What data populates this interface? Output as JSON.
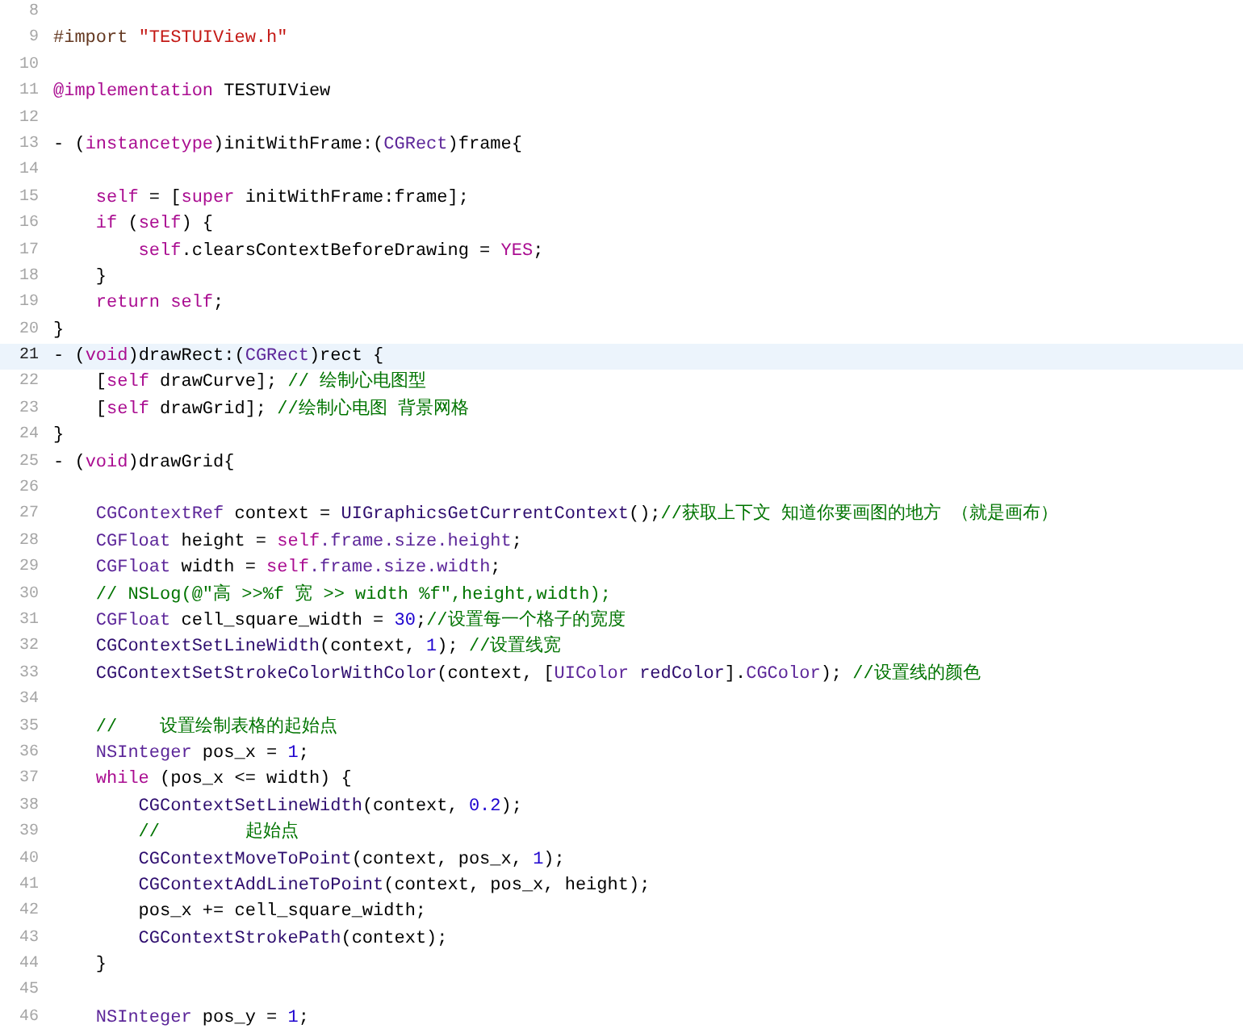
{
  "editor": {
    "lines": [
      {
        "number": "8",
        "current": false
      },
      {
        "number": "9",
        "current": false,
        "tokens": [
          {
            "kind": "preproc",
            "text": "#import "
          },
          {
            "kind": "string",
            "text": "\"TESTUIView.h\""
          }
        ]
      },
      {
        "number": "10",
        "current": false
      },
      {
        "number": "11",
        "current": false,
        "tokens": [
          {
            "kind": "keyword",
            "text": "@implementation"
          },
          {
            "kind": "plain",
            "text": " TESTUIView"
          }
        ]
      },
      {
        "number": "12",
        "current": false
      },
      {
        "number": "13",
        "current": false,
        "tokens": [
          {
            "kind": "plain",
            "text": "- ("
          },
          {
            "kind": "keyword",
            "text": "instancetype"
          },
          {
            "kind": "plain",
            "text": ")initWithFrame:("
          },
          {
            "kind": "type",
            "text": "CGRect"
          },
          {
            "kind": "plain",
            "text": ")frame{"
          }
        ]
      },
      {
        "number": "14",
        "current": false
      },
      {
        "number": "15",
        "current": false,
        "tokens": [
          {
            "kind": "keyword",
            "text": "    self"
          },
          {
            "kind": "plain",
            "text": " = ["
          },
          {
            "kind": "keyword",
            "text": "super"
          },
          {
            "kind": "plain",
            "text": " initWithFrame:frame];"
          }
        ]
      },
      {
        "number": "16",
        "current": false,
        "tokens": [
          {
            "kind": "keyword",
            "text": "    if"
          },
          {
            "kind": "plain",
            "text": " ("
          },
          {
            "kind": "keyword",
            "text": "self"
          },
          {
            "kind": "plain",
            "text": ") {"
          }
        ]
      },
      {
        "number": "17",
        "current": false,
        "tokens": [
          {
            "kind": "keyword",
            "text": "        self"
          },
          {
            "kind": "plain",
            "text": ".clearsContextBeforeDrawing = "
          },
          {
            "kind": "keyword",
            "text": "YES"
          },
          {
            "kind": "plain",
            "text": ";"
          }
        ]
      },
      {
        "number": "18",
        "current": false,
        "tokens": [
          {
            "kind": "plain",
            "text": "    }"
          }
        ]
      },
      {
        "number": "19",
        "current": false,
        "tokens": [
          {
            "kind": "keyword",
            "text": "    return self"
          },
          {
            "kind": "plain",
            "text": ";"
          }
        ]
      },
      {
        "number": "20",
        "current": false,
        "tokens": [
          {
            "kind": "plain",
            "text": "}"
          }
        ]
      },
      {
        "number": "21",
        "current": true,
        "tokens": [
          {
            "kind": "plain",
            "text": "- ("
          },
          {
            "kind": "keyword",
            "text": "void"
          },
          {
            "kind": "plain",
            "text": ")drawRect:("
          },
          {
            "kind": "type",
            "text": "CGRect"
          },
          {
            "kind": "plain",
            "text": ")rect {"
          }
        ]
      },
      {
        "number": "22",
        "current": false,
        "tokens": [
          {
            "kind": "plain",
            "text": "    ["
          },
          {
            "kind": "keyword",
            "text": "self"
          },
          {
            "kind": "plain",
            "text": " drawCurve]; "
          },
          {
            "kind": "comment",
            "text": "// 绘制心电图型"
          }
        ]
      },
      {
        "number": "23",
        "current": false,
        "tokens": [
          {
            "kind": "plain",
            "text": "    ["
          },
          {
            "kind": "keyword",
            "text": "self"
          },
          {
            "kind": "plain",
            "text": " drawGrid]; "
          },
          {
            "kind": "comment",
            "text": "//绘制心电图 背景网格"
          }
        ]
      },
      {
        "number": "24",
        "current": false,
        "tokens": [
          {
            "kind": "plain",
            "text": "}"
          }
        ]
      },
      {
        "number": "25",
        "current": false,
        "tokens": [
          {
            "kind": "plain",
            "text": "- ("
          },
          {
            "kind": "keyword",
            "text": "void"
          },
          {
            "kind": "plain",
            "text": ")drawGrid{"
          }
        ]
      },
      {
        "number": "26",
        "current": false
      },
      {
        "number": "27",
        "current": false,
        "tokens": [
          {
            "kind": "type",
            "text": "    CGContextRef"
          },
          {
            "kind": "plain",
            "text": " context = "
          },
          {
            "kind": "func",
            "text": "UIGraphicsGetCurrentContext"
          },
          {
            "kind": "plain",
            "text": "();"
          },
          {
            "kind": "comment",
            "text": "//获取上下文 知道你要画图的地方 （就是画布）"
          }
        ]
      },
      {
        "number": "28",
        "current": false,
        "tokens": [
          {
            "kind": "type",
            "text": "    CGFloat"
          },
          {
            "kind": "plain",
            "text": " height = "
          },
          {
            "kind": "keyword",
            "text": "self"
          },
          {
            "kind": "prop",
            "text": ".frame.size.height"
          },
          {
            "kind": "plain",
            "text": ";"
          }
        ]
      },
      {
        "number": "29",
        "current": false,
        "tokens": [
          {
            "kind": "type",
            "text": "    CGFloat"
          },
          {
            "kind": "plain",
            "text": " width = "
          },
          {
            "kind": "keyword",
            "text": "self"
          },
          {
            "kind": "prop",
            "text": ".frame.size.width"
          },
          {
            "kind": "plain",
            "text": ";"
          }
        ]
      },
      {
        "number": "30",
        "current": false,
        "tokens": [
          {
            "kind": "comment",
            "text": "    // NSLog(@\"高 >>%f 宽 >> width %f\",height,width);"
          }
        ]
      },
      {
        "number": "31",
        "current": false,
        "tokens": [
          {
            "kind": "type",
            "text": "    CGFloat"
          },
          {
            "kind": "plain",
            "text": " cell_square_width = "
          },
          {
            "kind": "number",
            "text": "30"
          },
          {
            "kind": "plain",
            "text": ";"
          },
          {
            "kind": "comment",
            "text": "//设置每一个格子的宽度"
          }
        ]
      },
      {
        "number": "32",
        "current": false,
        "tokens": [
          {
            "kind": "func",
            "text": "    CGContextSetLineWidth"
          },
          {
            "kind": "plain",
            "text": "(context, "
          },
          {
            "kind": "number",
            "text": "1"
          },
          {
            "kind": "plain",
            "text": "); "
          },
          {
            "kind": "comment",
            "text": "//设置线宽"
          }
        ]
      },
      {
        "number": "33",
        "current": false,
        "tokens": [
          {
            "kind": "func",
            "text": "    CGContextSetStrokeColorWithColor"
          },
          {
            "kind": "plain",
            "text": "(context, ["
          },
          {
            "kind": "type",
            "text": "UIColor"
          },
          {
            "kind": "func",
            "text": " redColor"
          },
          {
            "kind": "plain",
            "text": "]."
          },
          {
            "kind": "prop",
            "text": "CGColor"
          },
          {
            "kind": "plain",
            "text": "); "
          },
          {
            "kind": "comment",
            "text": "//设置线的颜色"
          }
        ]
      },
      {
        "number": "34",
        "current": false
      },
      {
        "number": "35",
        "current": false,
        "tokens": [
          {
            "kind": "comment",
            "text": "    //    设置绘制表格的起始点"
          }
        ]
      },
      {
        "number": "36",
        "current": false,
        "tokens": [
          {
            "kind": "type",
            "text": "    NSInteger"
          },
          {
            "kind": "plain",
            "text": " pos_x = "
          },
          {
            "kind": "number",
            "text": "1"
          },
          {
            "kind": "plain",
            "text": ";"
          }
        ]
      },
      {
        "number": "37",
        "current": false,
        "tokens": [
          {
            "kind": "keyword",
            "text": "    while"
          },
          {
            "kind": "plain",
            "text": " (pos_x <= width) {"
          }
        ]
      },
      {
        "number": "38",
        "current": false,
        "tokens": [
          {
            "kind": "func",
            "text": "        CGContextSetLineWidth"
          },
          {
            "kind": "plain",
            "text": "(context, "
          },
          {
            "kind": "number",
            "text": "0.2"
          },
          {
            "kind": "plain",
            "text": ");"
          }
        ]
      },
      {
        "number": "39",
        "current": false,
        "tokens": [
          {
            "kind": "comment",
            "text": "        //        起始点"
          }
        ]
      },
      {
        "number": "40",
        "current": false,
        "tokens": [
          {
            "kind": "func",
            "text": "        CGContextMoveToPoint"
          },
          {
            "kind": "plain",
            "text": "(context, pos_x, "
          },
          {
            "kind": "number",
            "text": "1"
          },
          {
            "kind": "plain",
            "text": ");"
          }
        ]
      },
      {
        "number": "41",
        "current": false,
        "tokens": [
          {
            "kind": "func",
            "text": "        CGContextAddLineToPoint"
          },
          {
            "kind": "plain",
            "text": "(context, pos_x, height);"
          }
        ]
      },
      {
        "number": "42",
        "current": false,
        "tokens": [
          {
            "kind": "plain",
            "text": "        pos_x += cell_square_width;"
          }
        ]
      },
      {
        "number": "43",
        "current": false,
        "tokens": [
          {
            "kind": "func",
            "text": "        CGContextStrokePath"
          },
          {
            "kind": "plain",
            "text": "(context);"
          }
        ]
      },
      {
        "number": "44",
        "current": false,
        "tokens": [
          {
            "kind": "plain",
            "text": "    }"
          }
        ]
      },
      {
        "number": "45",
        "current": false
      },
      {
        "number": "46",
        "current": false,
        "tokens": [
          {
            "kind": "type",
            "text": "    NSInteger"
          },
          {
            "kind": "plain",
            "text": " pos_y = "
          },
          {
            "kind": "number",
            "text": "1"
          },
          {
            "kind": "plain",
            "text": ";"
          }
        ]
      }
    ]
  }
}
